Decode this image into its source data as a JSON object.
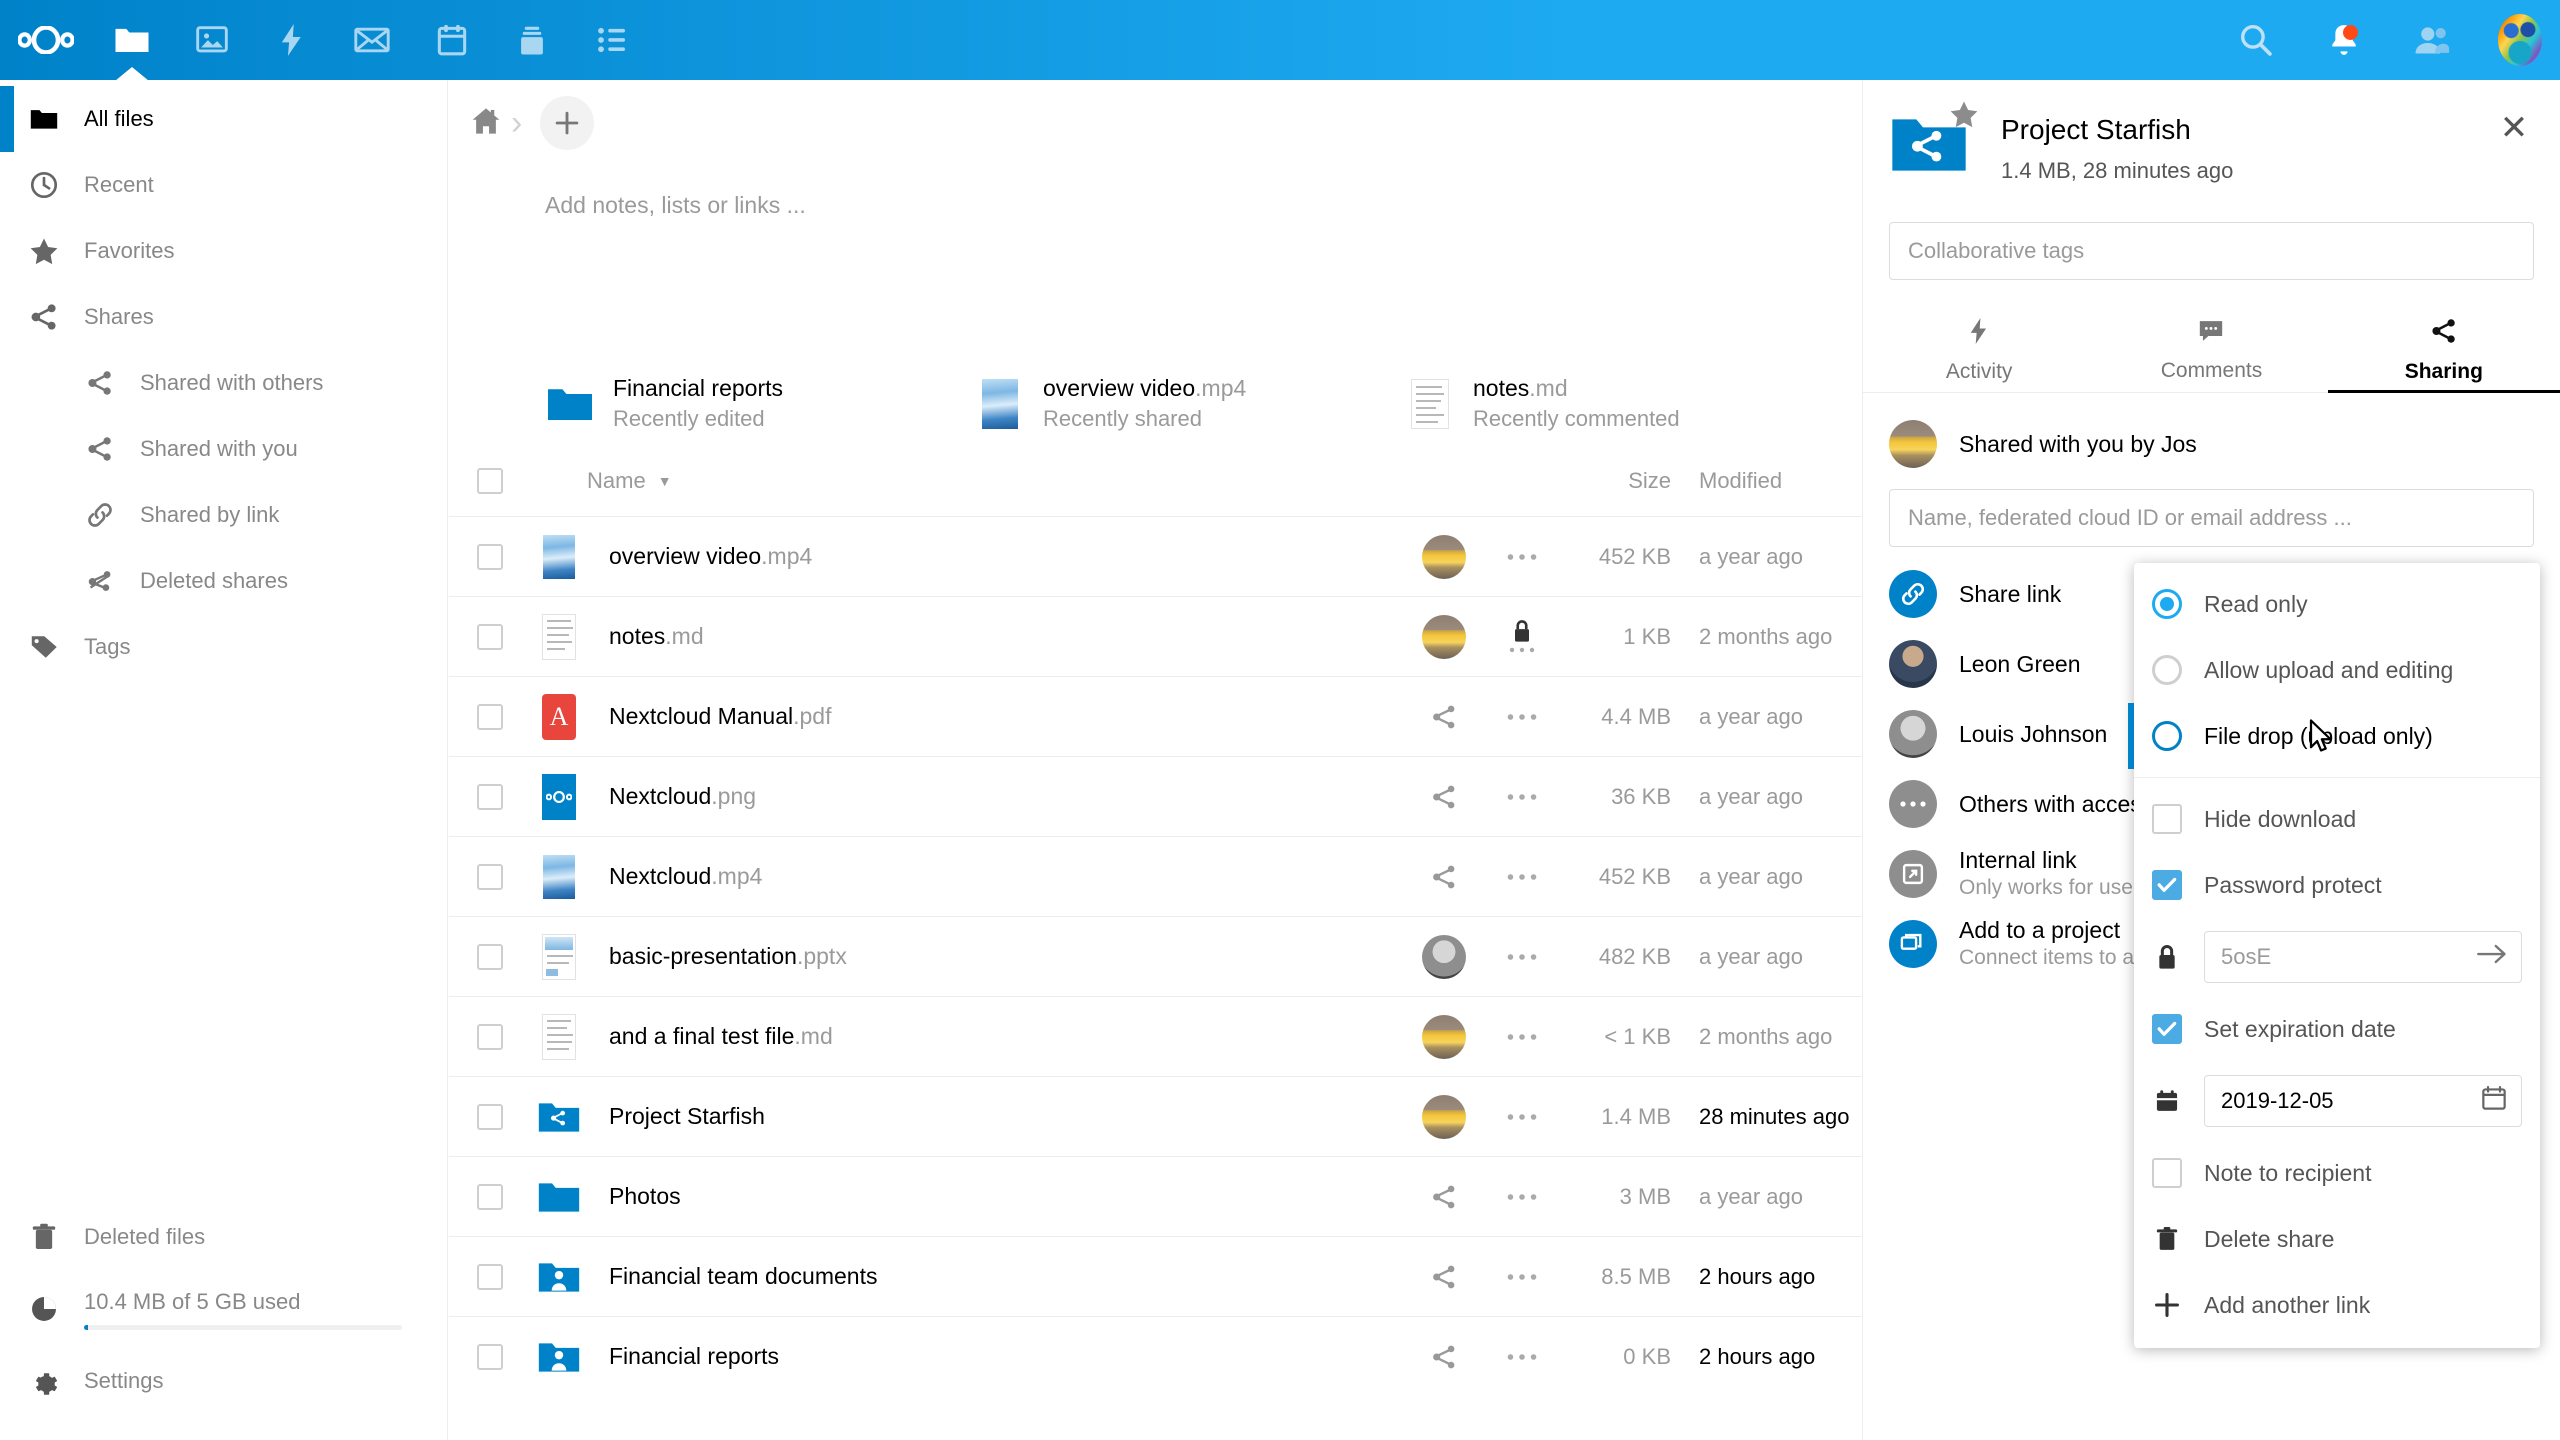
{
  "app": {
    "name": "Nextcloud",
    "apps": [
      {
        "name": "files",
        "icon": "folder-icon",
        "label": "Files",
        "active": true
      },
      {
        "name": "photos",
        "icon": "photos-icon",
        "label": "Photos",
        "active": false
      },
      {
        "name": "activity",
        "icon": "lightning-icon",
        "label": "Activity",
        "active": false
      },
      {
        "name": "mail",
        "icon": "mail-icon",
        "label": "Mail",
        "active": false
      },
      {
        "name": "calendar",
        "icon": "calendar-icon",
        "label": "Calendar",
        "active": false
      },
      {
        "name": "deck",
        "icon": "deck-icon",
        "label": "Deck",
        "active": false
      },
      {
        "name": "tasks",
        "icon": "tasks-icon",
        "label": "Tasks",
        "active": false
      }
    ],
    "header_right": [
      {
        "name": "search",
        "icon": "search-icon"
      },
      {
        "name": "notifications",
        "icon": "bell-icon",
        "badge": true
      },
      {
        "name": "contacts",
        "icon": "contacts-icon"
      },
      {
        "name": "user-avatar",
        "icon": "avatar"
      }
    ]
  },
  "sidebar": {
    "items": [
      {
        "label": "All files",
        "icon": "folder-icon",
        "active": true,
        "sub": false
      },
      {
        "label": "Recent",
        "icon": "clock-icon",
        "active": false,
        "sub": false
      },
      {
        "label": "Favorites",
        "icon": "star-icon",
        "active": false,
        "sub": false
      },
      {
        "label": "Shares",
        "icon": "share-icon",
        "active": false,
        "sub": false
      },
      {
        "label": "Shared with others",
        "icon": "share-icon",
        "active": false,
        "sub": true
      },
      {
        "label": "Shared with you",
        "icon": "share-icon",
        "active": false,
        "sub": true
      },
      {
        "label": "Shared by link",
        "icon": "link-icon",
        "active": false,
        "sub": true
      },
      {
        "label": "Deleted shares",
        "icon": "share-off-icon",
        "active": false,
        "sub": true
      },
      {
        "label": "Tags",
        "icon": "tag-icon",
        "active": false,
        "sub": false
      }
    ],
    "bottom": {
      "deleted_files": "Deleted files",
      "quota": "10.4 MB of 5 GB used",
      "quota_percent": 0.2,
      "settings": "Settings"
    }
  },
  "main": {
    "breadcrumb": {
      "home": "home-icon",
      "separator": "›",
      "new_button": "+"
    },
    "notes_placeholder": "Add notes, lists or links ...",
    "recent": [
      {
        "name": "Financial reports",
        "ext": "",
        "caption": "Recently edited",
        "thumb": "folder-blue"
      },
      {
        "name": "overview video",
        "ext": ".mp4",
        "caption": "Recently shared",
        "thumb": "sky"
      },
      {
        "name": "notes",
        "ext": ".md",
        "caption": "Recently commented",
        "thumb": "doc"
      }
    ],
    "table": {
      "columns": {
        "name": "Name",
        "size": "Size",
        "modified": "Modified"
      },
      "sort_indicator": "▼",
      "rows": [
        {
          "name": "overview video",
          "ext": ".mp4",
          "thumb": "sky",
          "avatar": "taxi",
          "action": "none",
          "lock": false,
          "size": "452 KB",
          "modified": "a year ago",
          "recent": false
        },
        {
          "name": "notes",
          "ext": ".md",
          "thumb": "doc",
          "avatar": "taxi",
          "action": "lock",
          "lock": true,
          "size": "1 KB",
          "modified": "2 months ago",
          "recent": false
        },
        {
          "name": "Nextcloud Manual",
          "ext": ".pdf",
          "thumb": "pdf",
          "avatar": "none",
          "action": "share",
          "lock": false,
          "size": "4.4 MB",
          "modified": "a year ago",
          "recent": false
        },
        {
          "name": "Nextcloud",
          "ext": ".png",
          "thumb": "nclogo",
          "avatar": "none",
          "action": "share",
          "lock": false,
          "size": "36 KB",
          "modified": "a year ago",
          "recent": false
        },
        {
          "name": "Nextcloud",
          "ext": ".mp4",
          "thumb": "sky",
          "avatar": "none",
          "action": "share",
          "lock": false,
          "size": "452 KB",
          "modified": "a year ago",
          "recent": false
        },
        {
          "name": "basic-presentation",
          "ext": ".pptx",
          "thumb": "slide",
          "avatar": "grey",
          "action": "none",
          "lock": false,
          "size": "482 KB",
          "modified": "a year ago",
          "recent": false
        },
        {
          "name": "and a final test file",
          "ext": ".md",
          "thumb": "doc",
          "avatar": "taxi",
          "action": "none",
          "lock": false,
          "size": "< 1 KB",
          "modified": "2 months ago",
          "recent": false
        },
        {
          "name": "Project Starfish",
          "ext": "",
          "thumb": "folder-share",
          "avatar": "taxi",
          "action": "none",
          "lock": false,
          "size": "1.4 MB",
          "modified": "28 minutes ago",
          "recent": true
        },
        {
          "name": "Photos",
          "ext": "",
          "thumb": "folder-blue",
          "avatar": "none",
          "action": "share",
          "lock": false,
          "size": "3 MB",
          "modified": "a year ago",
          "recent": false
        },
        {
          "name": "Financial team documents",
          "ext": "",
          "thumb": "folder-group",
          "avatar": "none",
          "action": "share",
          "lock": false,
          "size": "8.5 MB",
          "modified": "2 hours ago",
          "recent": true
        },
        {
          "name": "Financial reports",
          "ext": "",
          "thumb": "folder-group",
          "avatar": "none",
          "action": "share",
          "lock": false,
          "size": "0 KB",
          "modified": "2 hours ago",
          "recent": true
        }
      ]
    }
  },
  "details_panel": {
    "file_title": "Project Starfish",
    "file_sub": "1.4 MB, 28 minutes ago",
    "favorited": true,
    "close_icon": "✕",
    "tags_placeholder": "Collaborative tags",
    "tabs": [
      {
        "label": "Activity",
        "icon": "lightning-icon",
        "active": false
      },
      {
        "label": "Comments",
        "icon": "comment-icon",
        "active": false
      },
      {
        "label": "Sharing",
        "icon": "share-icon",
        "active": true
      }
    ],
    "shared_by": "Shared with you by Jos",
    "recipient_placeholder": "Name, federated cloud ID or email address ...",
    "share_link": {
      "label": "Share link",
      "copy_icon": "copy-link-icon",
      "menu_icon": "three-dots-icon"
    },
    "shares": [
      {
        "name": "Leon Green",
        "avatar": "person-dark",
        "sub": ""
      },
      {
        "name": "Louis Johnson",
        "avatar": "person-grey",
        "sub": ""
      },
      {
        "name": "Others with access",
        "avatar": "dots-grey",
        "sub": ""
      },
      {
        "name": "Internal link",
        "avatar": "external-grey",
        "sub": "Only works for users with access to this folder"
      },
      {
        "name": "Add to a project",
        "avatar": "project-blue",
        "sub": "Connect items to a project to make them easier to find"
      }
    ]
  },
  "share_menu": {
    "permission_options": [
      {
        "label": "Read only",
        "type": "radio",
        "checked": true,
        "focused": false
      },
      {
        "label": "Allow upload and editing",
        "type": "radio",
        "checked": false,
        "focused": false
      },
      {
        "label": "File drop (upload only)",
        "type": "radio",
        "checked": false,
        "focused": true
      }
    ],
    "toggles": [
      {
        "label": "Hide download",
        "type": "checkbox",
        "checked": false
      },
      {
        "label": "Password protect",
        "type": "checkbox",
        "checked": true
      }
    ],
    "password_field": {
      "icon": "lock-icon",
      "value": "5osE",
      "is_placeholder": true,
      "submit_icon": "arrow-right-icon"
    },
    "expiration_toggle": {
      "label": "Set expiration date",
      "type": "checkbox",
      "checked": true
    },
    "expiration_field": {
      "icon": "calendar-icon",
      "value": "2019-12-05",
      "picker_icon": "calendar-picker-icon"
    },
    "note_toggle": {
      "label": "Note to recipient",
      "type": "checkbox",
      "checked": false
    },
    "actions": [
      {
        "label": "Delete share",
        "icon": "trash-icon"
      },
      {
        "label": "Add another link",
        "icon": "plus-icon"
      }
    ]
  },
  "colors": {
    "brand_blue": "#0082c9",
    "header_blue_light": "#1eaaf1",
    "accent_checkbox": "#4dabe4",
    "notification_red": "#ff4a18",
    "text_muted": "#9a9a9a"
  }
}
